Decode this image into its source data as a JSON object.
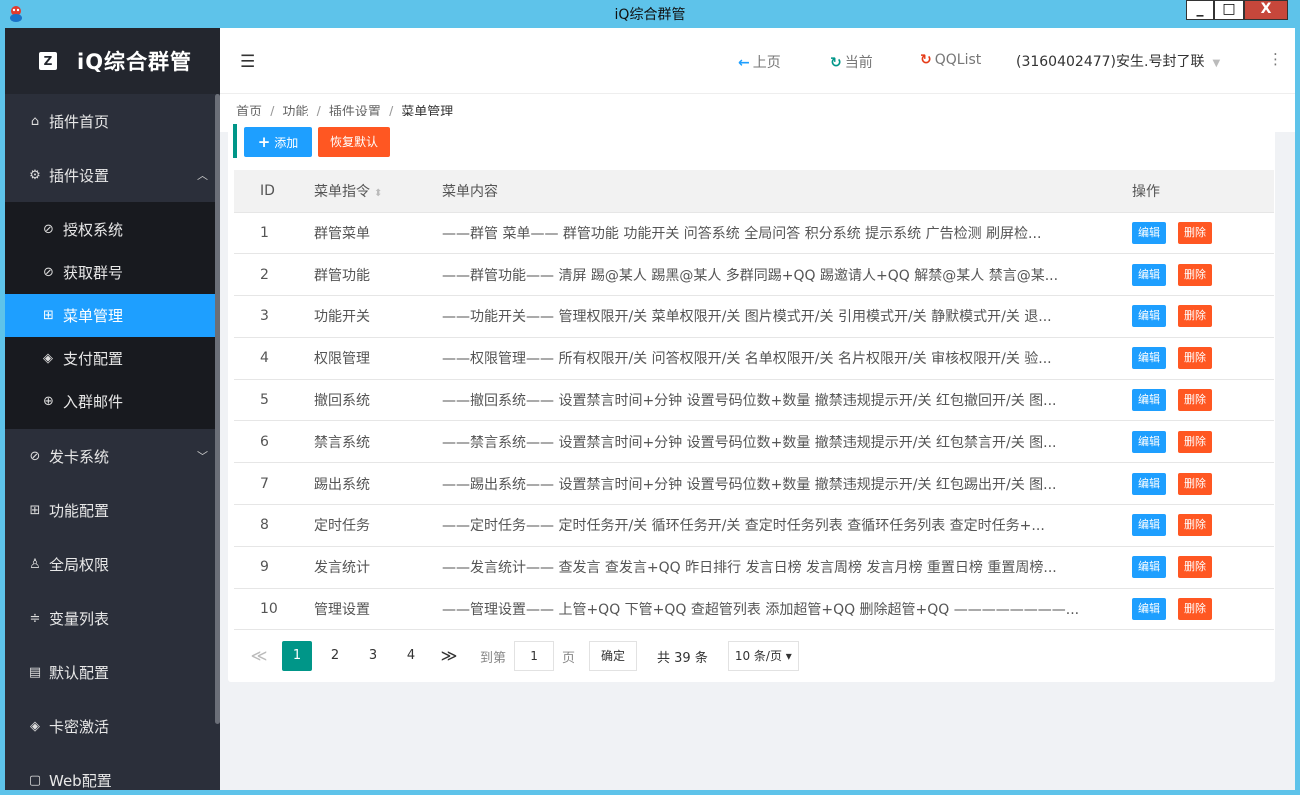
{
  "window": {
    "title": "iQ综合群管",
    "min": "_",
    "max": "□",
    "close": "X"
  },
  "sidebar": {
    "brand_logo": "Z",
    "brand": "iQ综合群管",
    "items": [
      {
        "icon": "⌂",
        "label": "插件首页"
      },
      {
        "icon": "⚙",
        "label": "插件设置",
        "arrow": "︿"
      },
      {
        "icon": "⊘",
        "label": "发卡系统",
        "arrow": "﹀"
      },
      {
        "icon": "⊞",
        "label": "功能配置"
      },
      {
        "icon": "♙",
        "label": "全局权限"
      },
      {
        "icon": "≑",
        "label": "变量列表"
      },
      {
        "icon": "▤",
        "label": "默认配置"
      },
      {
        "icon": "◈",
        "label": "卡密激活"
      },
      {
        "icon": "▢",
        "label": "Web配置"
      }
    ],
    "submenu": [
      {
        "icon": "⊘",
        "label": "授权系统"
      },
      {
        "icon": "⊘",
        "label": "获取群号"
      },
      {
        "icon": "⊞",
        "label": "菜单管理"
      },
      {
        "icon": "◈",
        "label": "支付配置"
      },
      {
        "icon": "⊕",
        "label": "入群邮件"
      }
    ]
  },
  "header": {
    "back": "上页",
    "refresh": "当前",
    "qqlist": "QQList",
    "user": "(3160402477)安生.号封了联"
  },
  "breadcrumb": [
    "首页",
    "功能",
    "插件设置",
    "菜单管理"
  ],
  "toolbar": {
    "add": "添加",
    "reset": "恢复默认"
  },
  "table": {
    "headers": {
      "id": "ID",
      "cmd": "菜单指令",
      "content": "菜单内容",
      "op": "操作"
    },
    "edit": "编辑",
    "del": "删除",
    "rows": [
      {
        "id": "1",
        "cmd": "群管菜单",
        "content": "——群管 菜单—— 群管功能 功能开关 问答系统 全局问答 积分系统 提示系统 广告检测 刷屏检..."
      },
      {
        "id": "2",
        "cmd": "群管功能",
        "content": "——群管功能—— 清屏 踢@某人 踢黑@某人 多群同踢+QQ 踢邀请人+QQ 解禁@某人 禁言@某..."
      },
      {
        "id": "3",
        "cmd": "功能开关",
        "content": "——功能开关—— 管理权限开/关 菜单权限开/关 图片模式开/关 引用模式开/关 静默模式开/关 退..."
      },
      {
        "id": "4",
        "cmd": "权限管理",
        "content": "——权限管理—— 所有权限开/关 问答权限开/关 名单权限开/关 名片权限开/关 审核权限开/关 验..."
      },
      {
        "id": "5",
        "cmd": "撤回系统",
        "content": "——撤回系统—— 设置禁言时间+分钟 设置号码位数+数量 撤禁违规提示开/关 红包撤回开/关 图..."
      },
      {
        "id": "6",
        "cmd": "禁言系统",
        "content": "——禁言系统—— 设置禁言时间+分钟 设置号码位数+数量 撤禁违规提示开/关 红包禁言开/关 图..."
      },
      {
        "id": "7",
        "cmd": "踢出系统",
        "content": "——踢出系统—— 设置禁言时间+分钟 设置号码位数+数量 撤禁违规提示开/关 红包踢出开/关 图..."
      },
      {
        "id": "8",
        "cmd": "定时任务",
        "content": "——定时任务—— 定时任务开/关 循环任务开/关 查定时任务列表 查循环任务列表 查定时任务+..."
      },
      {
        "id": "9",
        "cmd": "发言统计",
        "content": "——发言统计—— 查发言 查发言+QQ 昨日排行 发言日榜 发言周榜 发言月榜 重置日榜 重置周榜..."
      },
      {
        "id": "10",
        "cmd": "管理设置",
        "content": "——管理设置—— 上管+QQ 下管+QQ 查超管列表 添加超管+QQ 删除超管+QQ ————————..."
      }
    ]
  },
  "pager": {
    "prev": "≪",
    "pages": [
      "1",
      "2",
      "3",
      "4"
    ],
    "next": "≫",
    "goto": "到第",
    "page_value": "1",
    "page_unit": "页",
    "ok": "确定",
    "total": "共 39 条",
    "size": "10 条/页 ▾"
  },
  "colors": {
    "accent": "#1e9fff",
    "danger": "#ff5722",
    "teal": "#009688",
    "sidebar": "#2b2f3a"
  }
}
